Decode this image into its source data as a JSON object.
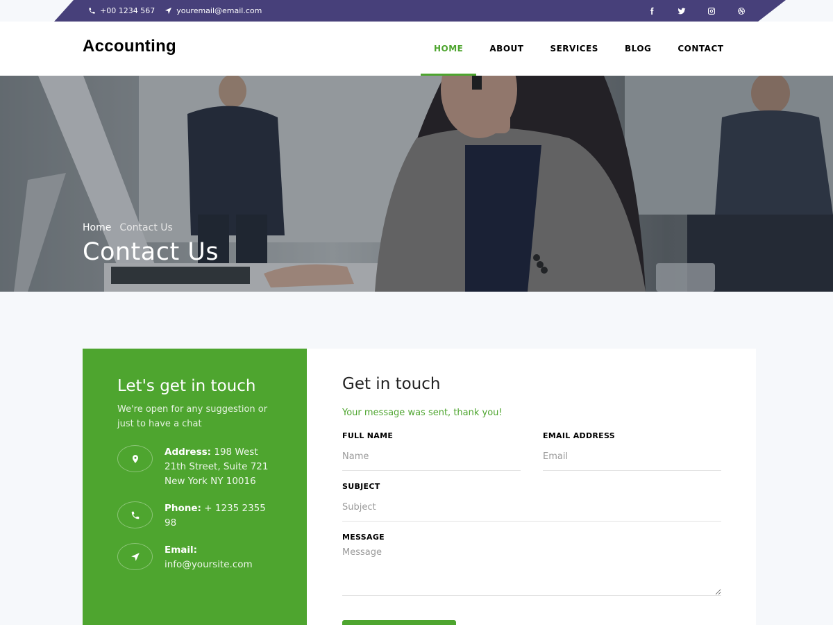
{
  "topbar": {
    "phone": "+00 1234 567",
    "email": "youremail@email.com",
    "social": [
      {
        "name": "facebook-icon"
      },
      {
        "name": "twitter-icon"
      },
      {
        "name": "instagram-icon"
      },
      {
        "name": "dribbble-icon"
      }
    ],
    "bg_color": "#47407a"
  },
  "nav": {
    "brand": "Accounting",
    "items": [
      {
        "label": "HOME",
        "active": true
      },
      {
        "label": "ABOUT",
        "active": false
      },
      {
        "label": "SERVICES",
        "active": false
      },
      {
        "label": "BLOG",
        "active": false
      },
      {
        "label": "CONTACT",
        "active": false
      }
    ],
    "accent_color": "#4ea52f"
  },
  "hero": {
    "breadcrumb": {
      "home": "Home",
      "current": "Contact Us"
    },
    "title": "Contact Us"
  },
  "info": {
    "title": "Let's get in touch",
    "subtitle": "We're open for any suggestion or just to have a chat",
    "address_label": "Address:",
    "address_value": "198 West 21th Street, Suite 721 New York NY 10016",
    "phone_label": "Phone:",
    "phone_value": "+ 1235 2355 98",
    "email_label": "Email:",
    "email_value": "info@yoursite.com",
    "panel_color": "#4ea52f"
  },
  "form": {
    "title": "Get in touch",
    "success_message": "Your message was sent, thank you!",
    "full_name_label": "FULL NAME",
    "full_name_placeholder": "Name",
    "email_label": "EMAIL ADDRESS",
    "email_placeholder": "Email",
    "subject_label": "SUBJECT",
    "subject_placeholder": "Subject",
    "message_label": "MESSAGE",
    "message_placeholder": "Message"
  }
}
